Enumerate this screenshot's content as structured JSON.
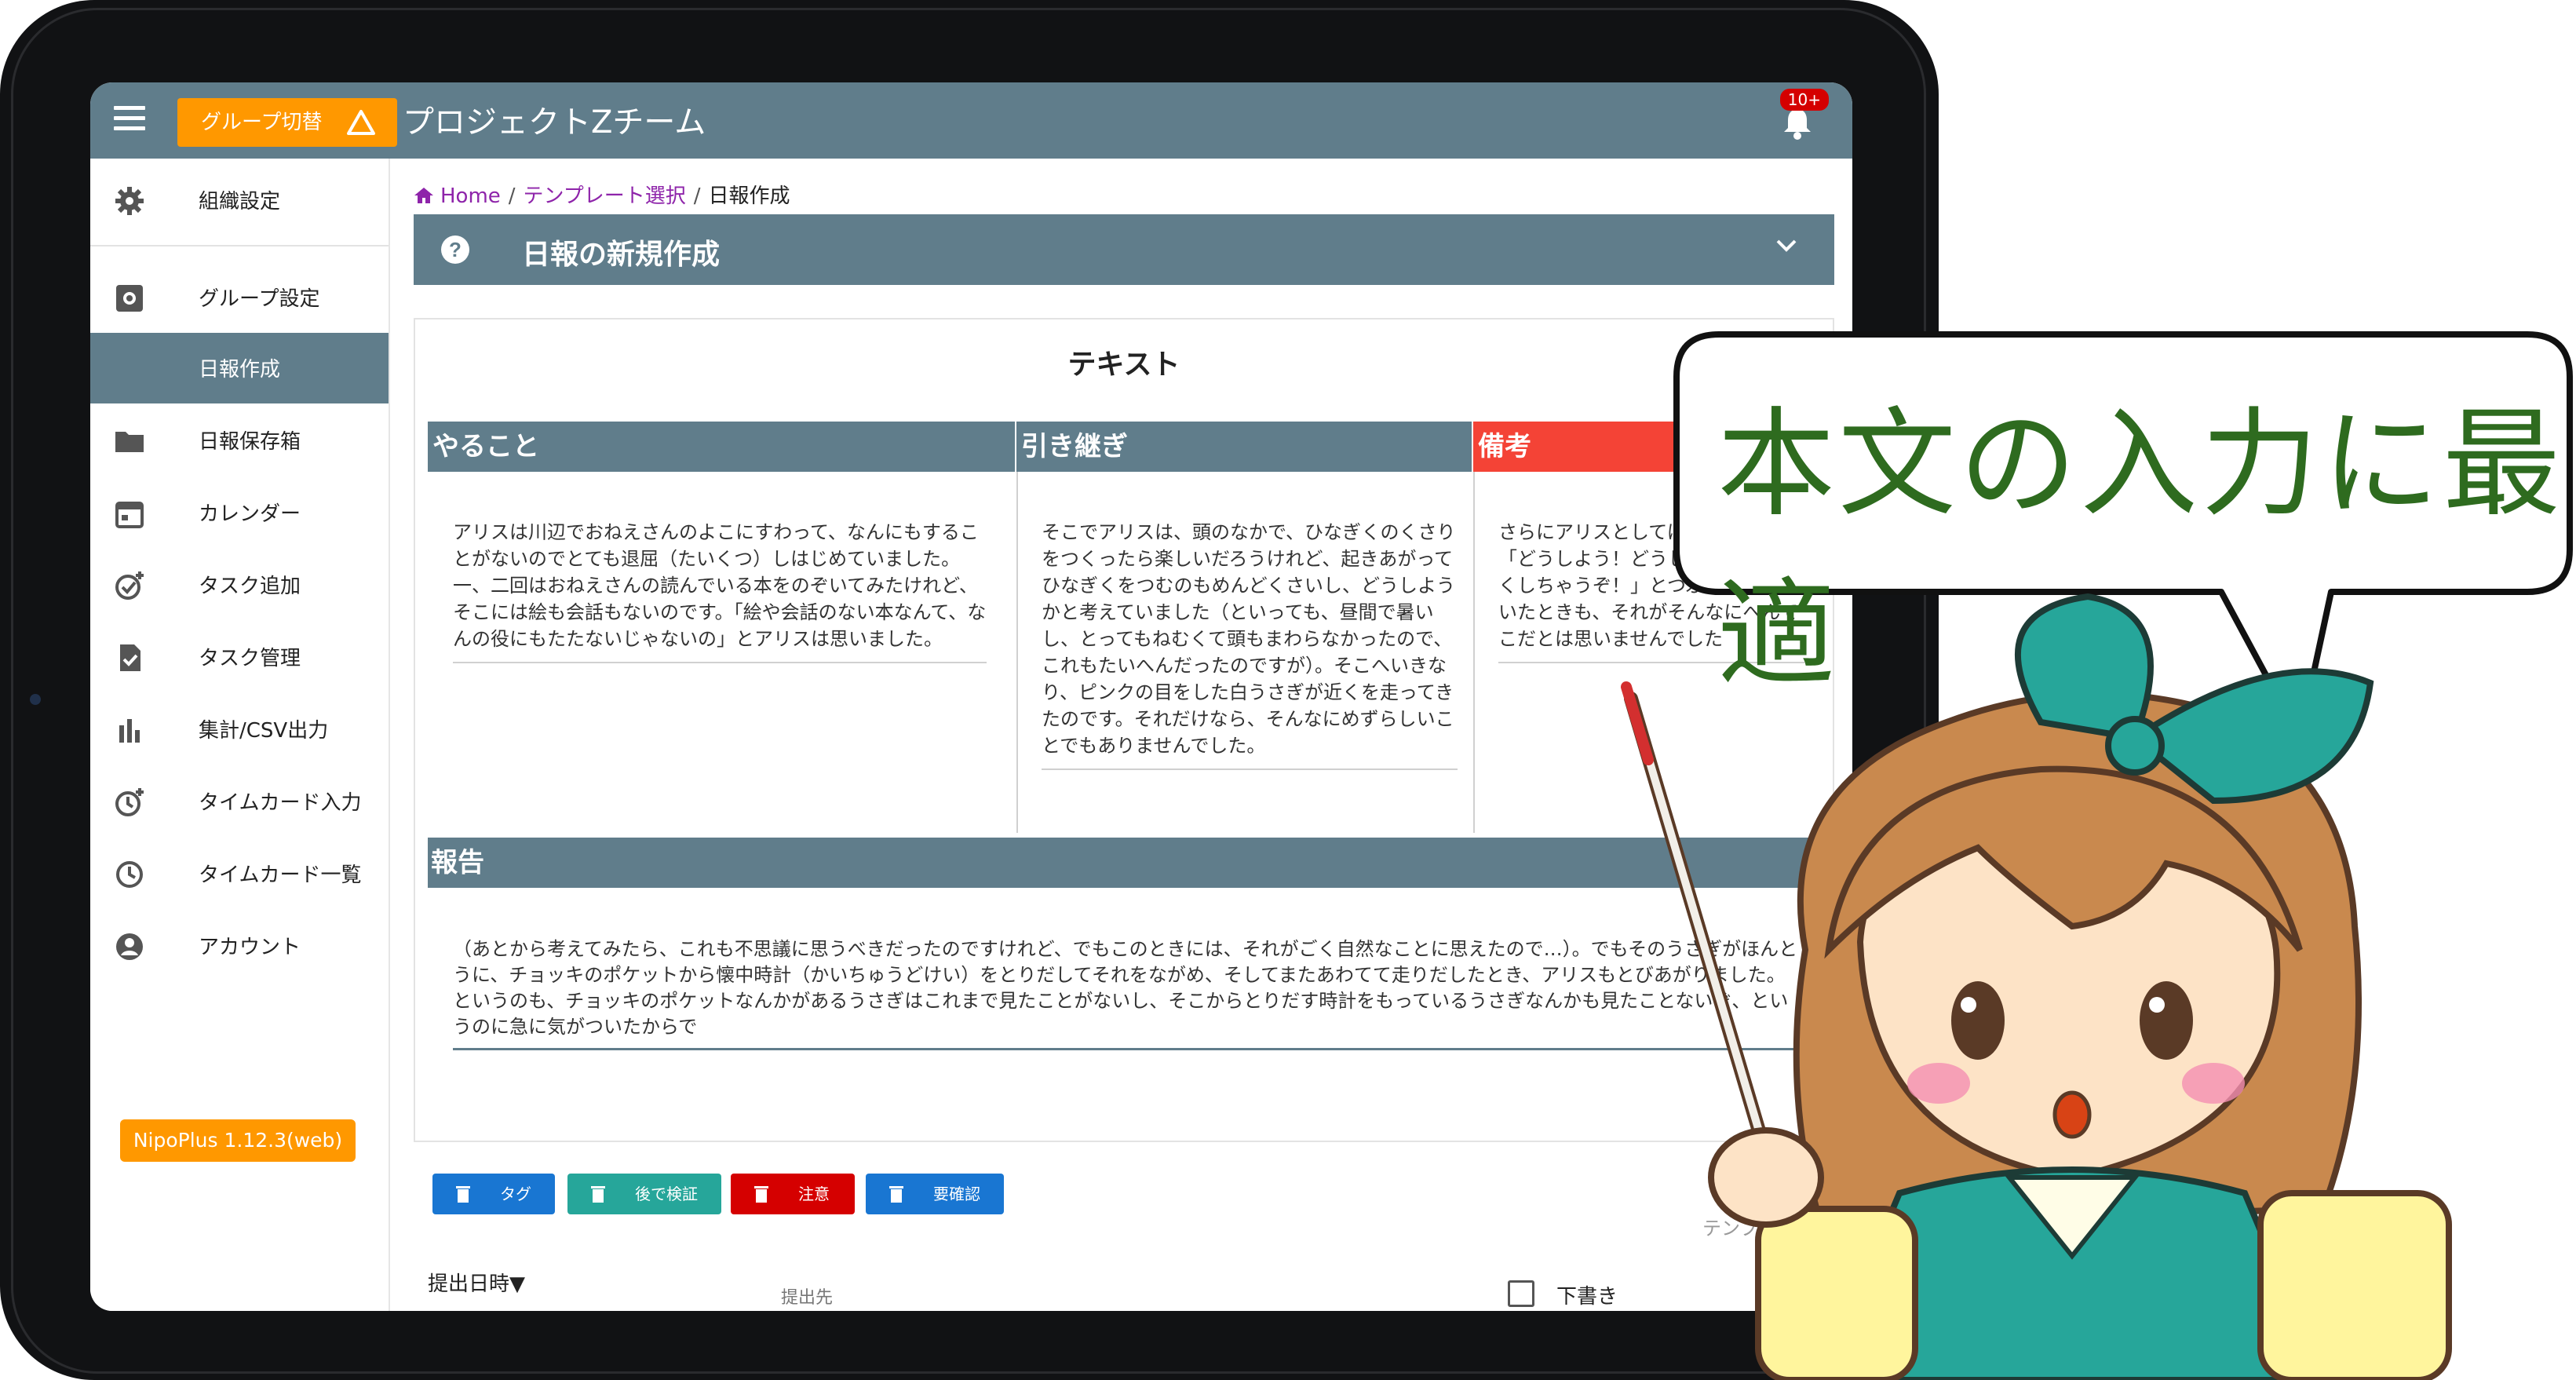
{
  "appbar": {
    "group_switch_label": "グループ切替",
    "project_title": "プロジェクトZチーム",
    "notification_badge": "10+"
  },
  "sidebar": {
    "items": [
      {
        "label": "組織設定",
        "icon": "gear-icon"
      },
      {
        "label": "グループ設定",
        "icon": "settings-box-icon"
      },
      {
        "label": "日報作成",
        "icon": "",
        "active": true
      },
      {
        "label": "日報保存箱",
        "icon": "folder-icon"
      },
      {
        "label": "カレンダー",
        "icon": "calendar-icon"
      },
      {
        "label": "タスク追加",
        "icon": "check-plus-icon"
      },
      {
        "label": "タスク管理",
        "icon": "task-file-icon"
      },
      {
        "label": "集計/CSV出力",
        "icon": "bar-chart-icon"
      },
      {
        "label": "タイムカード入力",
        "icon": "clock-plus-icon"
      },
      {
        "label": "タイムカード一覧",
        "icon": "clock-icon"
      },
      {
        "label": "アカウント",
        "icon": "account-icon"
      }
    ],
    "version": "NipoPlus 1.12.3(web)"
  },
  "breadcrumb": {
    "home": "Home",
    "template_select": "テンプレート選択",
    "current": "日報作成"
  },
  "page": {
    "title": "日報の新規作成"
  },
  "template": {
    "title": "テキスト",
    "columns": [
      {
        "header": "やること",
        "text": "アリスは川辺でおねえさんのよこにすわって、なんにもすることがないのでとても退屈（たいくつ）しはじめていました。一、二回はおねえさんの読んでいる本をのぞいてみたけれど、そこには絵も会話もないのです。「絵や会話のない本なんて、なんの役にもたたないじゃないの」とアリスは思いました。"
      },
      {
        "header": "引き継ぎ",
        "text": "そこでアリスは、頭のなかで、ひなぎくのくさりをつくったら楽しいだろうけれど、起きあがってひなぎくをつむのもめんどくさいし、どうしようかと考えていました（といっても、昼間で暑いし、とってもねむくて頭もまわらなかったので、これもたいへんだったのですが）。そこへいきなり、ピンクの目をした白うさぎが近くを走ってきたのです。それだけなら、そんなにめずらしいことでもありませんでした。"
      },
      {
        "header": "備考",
        "text": "さらにアリスとしては、うさぎが「どうしよう！どうしよう！　ちこくしちゃうぞ！」とつぶやくのを聞いたときも、それがそんなにへんてこだとは思いませんでした"
      }
    ],
    "report": {
      "header": "報告",
      "text": "（あとから考えてみたら、これも不思議に思うべきだったのですけれど、でもこのときには、それがごく自然なことに思えたので…）。でもそのうさぎがほんとうに、チョッキのポケットから懐中時計（かいちゅうどけい）をとりだしてそれをながめ、そしてまたあわてて走りだしたとき、アリスもとびあがりました。というのも、チョッキのポケットなんかがあるうさぎはこれまで見たことがないし、そこからとりだす時計をもっているうさぎなんかも見たことないぞ、というのに急に気がついたからで"
    },
    "tags": [
      {
        "label": "タグ",
        "color": "#1976d2"
      },
      {
        "label": "後で検証",
        "color": "#26a69a"
      },
      {
        "label": "注意",
        "color": "#d50000"
      },
      {
        "label": "要確認",
        "color": "#1976d2"
      }
    ],
    "template_link": "テンプ"
  },
  "footer": {
    "submit_datetime": "提出日時▼",
    "destination": "提出先",
    "draft": "下書き"
  },
  "callout": {
    "text": "本文の入力に最適"
  },
  "colors": {
    "primary": "#607d8b",
    "accent": "#ff9800",
    "danger": "#f44336",
    "callout_text": "#2e6b1f"
  }
}
